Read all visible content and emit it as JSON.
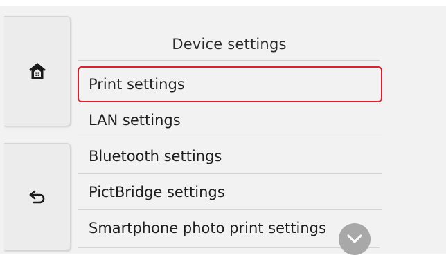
{
  "header": {
    "title": "Device settings"
  },
  "side": {
    "home_icon": "home-icon",
    "back_icon": "back-arrow-icon"
  },
  "menu": {
    "items": [
      {
        "label": "Print settings",
        "selected": true
      },
      {
        "label": "LAN settings",
        "selected": false
      },
      {
        "label": "Bluetooth settings",
        "selected": false
      },
      {
        "label": "PictBridge settings",
        "selected": false
      },
      {
        "label": "Smartphone photo print settings",
        "selected": false
      }
    ]
  },
  "scroll": {
    "icon": "chevron-down-icon"
  },
  "colors": {
    "selection_border": "#e0202a",
    "scroll_button": "#a8a8a8",
    "background": "#f2f2f2"
  }
}
